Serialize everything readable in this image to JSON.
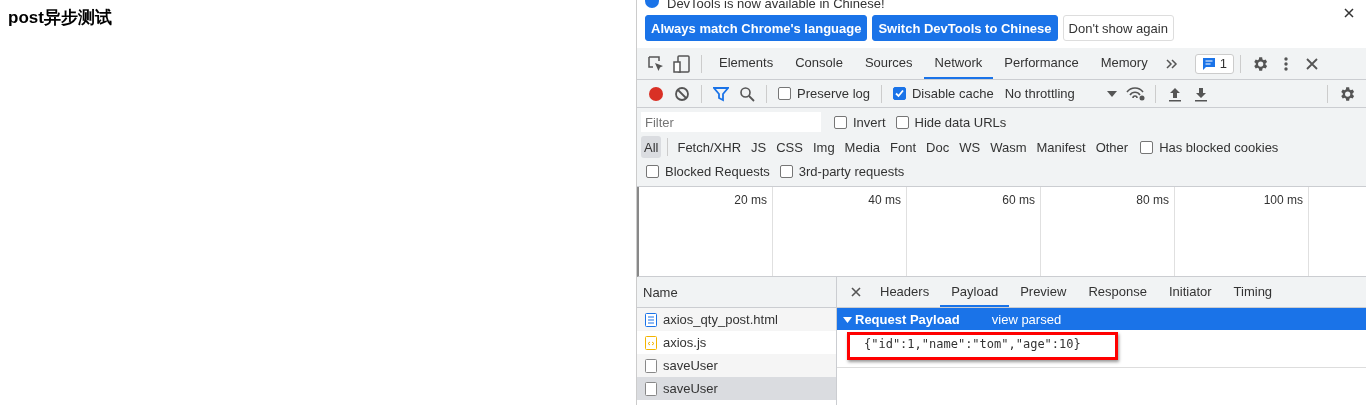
{
  "page": {
    "heading": "post异步测试"
  },
  "infobar": {
    "message": "DevTools is now available in Chinese!",
    "buttons": [
      {
        "label": "Always match Chrome's language",
        "primary": true
      },
      {
        "label": "Switch DevTools to Chinese",
        "primary": true
      },
      {
        "label": "Don't show again",
        "primary": false
      }
    ]
  },
  "tabs": [
    {
      "label": "Elements",
      "selected": false
    },
    {
      "label": "Console",
      "selected": false
    },
    {
      "label": "Sources",
      "selected": false
    },
    {
      "label": "Network",
      "selected": true
    },
    {
      "label": "Performance",
      "selected": false
    },
    {
      "label": "Memory",
      "selected": false
    }
  ],
  "issues_badge": "1",
  "toolbar": {
    "recording": true,
    "preserve_log": {
      "label": "Preserve log",
      "checked": false
    },
    "disable_cache": {
      "label": "Disable cache",
      "checked": true
    },
    "throttling": "No throttling"
  },
  "filter": {
    "placeholder": "Filter",
    "invert": {
      "label": "Invert",
      "checked": false
    },
    "hide_data_urls": {
      "label": "Hide data URLs",
      "checked": false
    }
  },
  "types": [
    {
      "label": "All",
      "selected": true
    },
    {
      "label": "Fetch/XHR",
      "selected": false
    },
    {
      "label": "JS",
      "selected": false
    },
    {
      "label": "CSS",
      "selected": false
    },
    {
      "label": "Img",
      "selected": false
    },
    {
      "label": "Media",
      "selected": false
    },
    {
      "label": "Font",
      "selected": false
    },
    {
      "label": "Doc",
      "selected": false
    },
    {
      "label": "WS",
      "selected": false
    },
    {
      "label": "Wasm",
      "selected": false
    },
    {
      "label": "Manifest",
      "selected": false
    },
    {
      "label": "Other",
      "selected": false
    }
  ],
  "has_blocked_cookies": {
    "label": "Has blocked cookies",
    "checked": false
  },
  "blocked_requests": {
    "label": "Blocked Requests",
    "checked": false
  },
  "third_party": {
    "label": "3rd-party requests",
    "checked": false
  },
  "timeline": {
    "ticks": [
      "20 ms",
      "40 ms",
      "60 ms",
      "80 ms",
      "100 ms"
    ]
  },
  "requests": {
    "column": "Name",
    "rows": [
      {
        "name": "axios_qty_post.html",
        "kind": "document",
        "selected": false
      },
      {
        "name": "axios.js",
        "kind": "script",
        "selected": false
      },
      {
        "name": "saveUser",
        "kind": "other",
        "selected": false
      },
      {
        "name": "saveUser",
        "kind": "other",
        "selected": true
      }
    ]
  },
  "detail_tabs": [
    {
      "label": "Headers",
      "selected": false
    },
    {
      "label": "Payload",
      "selected": true
    },
    {
      "label": "Preview",
      "selected": false
    },
    {
      "label": "Response",
      "selected": false
    },
    {
      "label": "Initiator",
      "selected": false
    },
    {
      "label": "Timing",
      "selected": false
    }
  ],
  "payload": {
    "title": "Request Payload",
    "expanded": true,
    "link": "view parsed",
    "body": "{\"id\":1,\"name\":\"tom\",\"age\":10}",
    "highlighted": true
  }
}
